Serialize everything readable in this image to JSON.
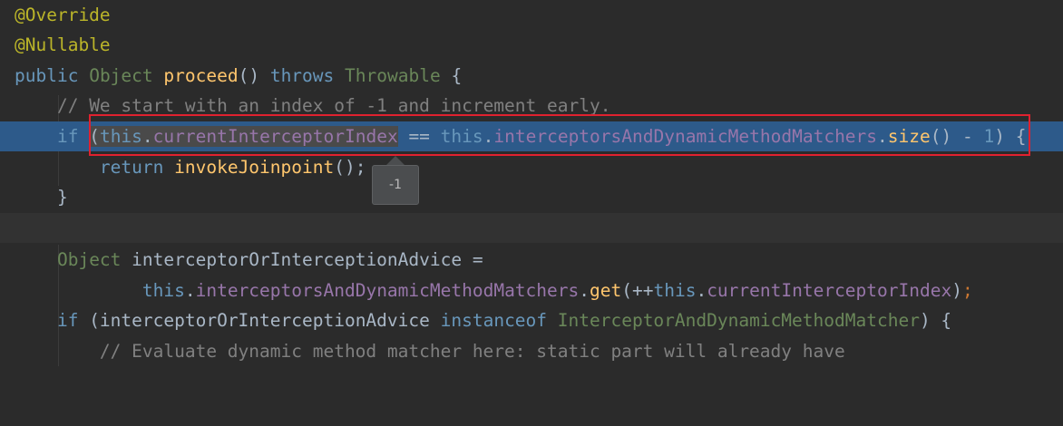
{
  "editor": {
    "lines": {
      "l1": {
        "annotation": "@Override"
      },
      "l2": {
        "annotation": "@Nullable"
      },
      "l3": {
        "kw_public": "public",
        "type_object": "Object",
        "method_name": "proceed",
        "parens": "()",
        "kw_throws": "throws",
        "type_throwable": "Throwable",
        "brace": "{"
      },
      "l4": {
        "comment": "// We start with an index of -1 and increment early."
      },
      "l5": {
        "kw_if": "if",
        "open_paren": "(",
        "this1": "this",
        "dot1": ".",
        "field1": "currentInterceptorIndex",
        "op_eq": " == ",
        "this2": "this",
        "dot2": ".",
        "field2": "interceptorsAndDynamicMethodMatchers",
        "dot3": ".",
        "method_size": "size",
        "call_parens": "()",
        "op_minus": " - ",
        "num_one": "1",
        "close_paren": ")",
        "brace": " {"
      },
      "l6": {
        "kw_return": "return",
        "method_invoke": "invokeJoinpoint",
        "rest": "();"
      },
      "l7": {
        "brace": "}"
      },
      "l9": {
        "type_object": "Object",
        "var_name": " interceptorOrInterceptionAdvice ",
        "assign": "="
      },
      "l10": {
        "this1": "this",
        "dot1": ".",
        "field": "interceptorsAndDynamicMethodMatchers",
        "dot2": ".",
        "method_get": "get",
        "open": "(++",
        "this2": "this",
        "dot3": ".",
        "field2": "currentInterceptorIndex",
        "close": ")",
        "semi": ";"
      },
      "l11": {
        "kw_if": "if",
        "open": " (interceptorOrInterceptionAdvice ",
        "kw_instanceof": "instanceof",
        "type": " InterceptorAndDynamicMethodMatcher",
        "close": ") {"
      },
      "l12": {
        "comment": "// Evaluate dynamic method matcher here: static part will already have"
      }
    },
    "tooltip_value": "-1"
  },
  "colors": {
    "background": "#2b2b2b",
    "execution_line": "#2d5a8a",
    "highlight_box": "#e0212f",
    "annotation": "#bbb529",
    "keyword_blue": "#6897bb",
    "field_purple": "#9876aa",
    "comment_gray": "#808080"
  }
}
